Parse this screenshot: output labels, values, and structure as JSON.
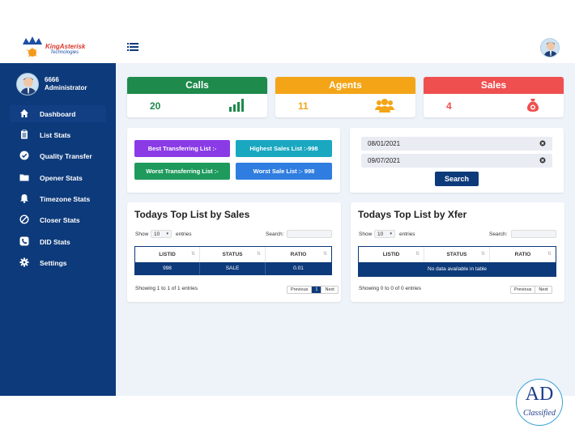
{
  "brand": {
    "name": "KingAsterisk",
    "sub": "Technologies"
  },
  "user": {
    "id": "6666",
    "role": "Administrator"
  },
  "nav": [
    {
      "label": "Dashboard",
      "icon": "home-icon",
      "active": true
    },
    {
      "label": "List Stats",
      "icon": "clipboard-icon"
    },
    {
      "label": "Quality Transfer",
      "icon": "check-circle-icon"
    },
    {
      "label": "Opener Stats",
      "icon": "folder-icon"
    },
    {
      "label": "Timezone Stats",
      "icon": "bell-icon"
    },
    {
      "label": "Closer Stats",
      "icon": "ban-icon"
    },
    {
      "label": "DID Stats",
      "icon": "phone-icon"
    },
    {
      "label": "Settings",
      "icon": "gear-icon"
    }
  ],
  "cards": {
    "calls": {
      "title": "Calls",
      "value": "20",
      "color": "#1e8a4c",
      "icon": "bar-chart-icon"
    },
    "agents": {
      "title": "Agents",
      "value": "11",
      "color": "#f3a517",
      "icon": "users-icon"
    },
    "sales": {
      "title": "Sales",
      "value": "4",
      "color": "#ef4f4f",
      "icon": "money-bag-icon"
    }
  },
  "list_buttons": {
    "best_transferring": "Best Transferring List :-",
    "highest_sales": "Highest Sales List :-998",
    "worst_transferring": "Worst Transferring List :-",
    "worst_sale": "Worst Sale List :- 998"
  },
  "filters": {
    "date_from": "08/01/2021",
    "date_to": "09/07/2021",
    "search_label": "Search"
  },
  "sales_table": {
    "title": "Todays Top List by Sales",
    "show": "Show",
    "length": "10",
    "entries": "entries",
    "search": "Search:",
    "columns": [
      "LISTID",
      "STATUS",
      "RATIO"
    ],
    "rows": [
      [
        "998",
        "SALE",
        "0.01"
      ]
    ],
    "info": "Showing 1 to 1 of 1 entries",
    "pager": {
      "prev": "Previous",
      "page": "1",
      "next": "Next"
    }
  },
  "xfer_table": {
    "title": "Todays Top List by Xfer",
    "show": "Show",
    "length": "10",
    "entries": "entries",
    "search": "Search:",
    "columns": [
      "LISTID",
      "STATUS",
      "RATIO"
    ],
    "empty": "No data available in table",
    "info": "Showing 0 to 0 of 0 entries",
    "pager": {
      "prev": "Previous",
      "next": "Next"
    }
  },
  "watermark": {
    "ad": "AD",
    "classified": "Classified"
  }
}
